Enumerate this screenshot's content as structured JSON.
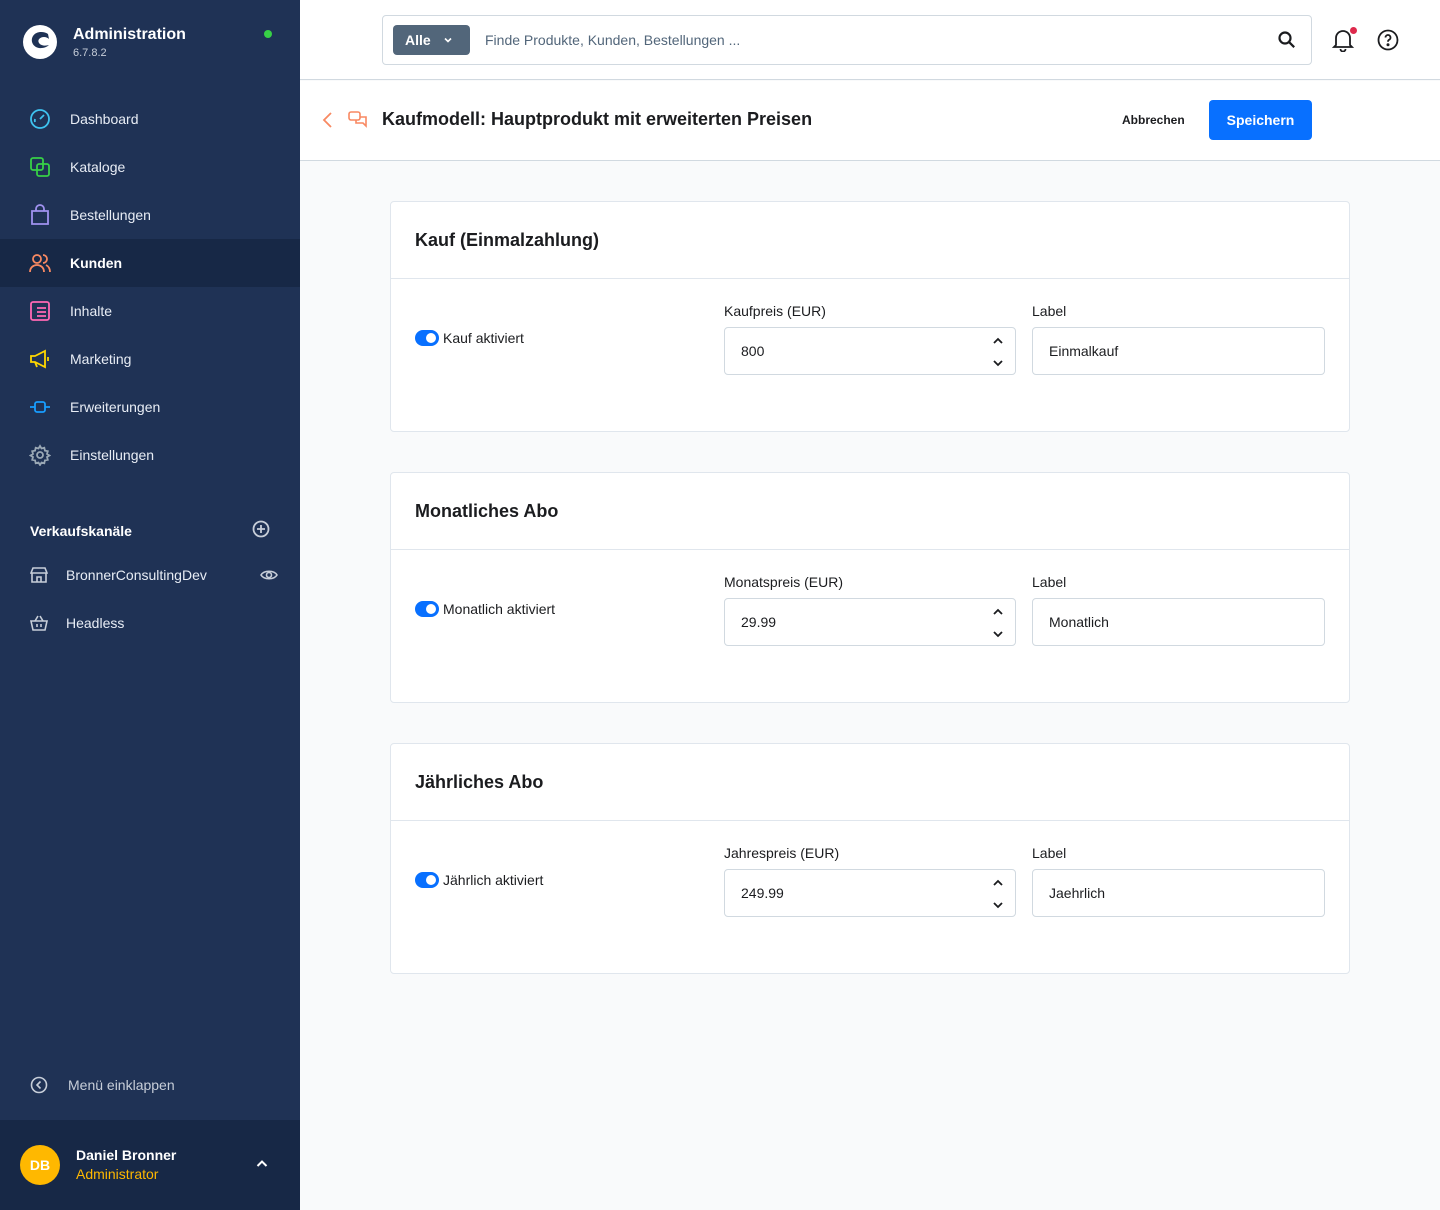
{
  "app": {
    "title": "Administration",
    "version": "6.7.8.2",
    "status_color": "#37d046"
  },
  "sidebar": {
    "items": [
      {
        "label": "Dashboard",
        "icon": "dashboard-icon",
        "color": "#3ec3f0"
      },
      {
        "label": "Kataloge",
        "icon": "catalog-icon",
        "color": "#37d046"
      },
      {
        "label": "Bestellungen",
        "icon": "shopping-bag-icon",
        "color": "#a092f0"
      },
      {
        "label": "Kunden",
        "icon": "users-icon",
        "color": "#f88962",
        "active": true
      },
      {
        "label": "Inhalte",
        "icon": "content-icon",
        "color": "#ff68b4"
      },
      {
        "label": "Marketing",
        "icon": "megaphone-icon",
        "color": "#ffd700"
      },
      {
        "label": "Erweiterungen",
        "icon": "plug-icon",
        "color": "#189eff"
      },
      {
        "label": "Einstellungen",
        "icon": "gear-icon",
        "color": "#9aa8b5"
      }
    ],
    "channels_title": "Verkaufskanäle",
    "channels": [
      {
        "label": "BronnerConsultingDev",
        "icon": "storefront-icon"
      },
      {
        "label": "Headless",
        "icon": "basket-icon"
      }
    ],
    "collapse_label": "Menü einklappen"
  },
  "user": {
    "initials": "DB",
    "name": "Daniel Bronner",
    "role": "Administrator"
  },
  "search": {
    "type_label": "Alle",
    "placeholder": "Finde Produkte, Kunden, Bestellungen ..."
  },
  "header": {
    "title": "Kaufmodell: Hauptprodukt mit erweiterten Preisen",
    "cancel_label": "Abbrechen",
    "save_label": "Speichern"
  },
  "cards": [
    {
      "title": "Kauf (Einmalzahlung)",
      "toggle_label": "Kauf aktiviert",
      "toggle_on": true,
      "price_label": "Kaufpreis (EUR)",
      "price_value": "800",
      "label_label": "Label",
      "label_value": "Einmalkauf"
    },
    {
      "title": "Monatliches Abo",
      "toggle_label": "Monatlich aktiviert",
      "toggle_on": true,
      "price_label": "Monatspreis (EUR)",
      "price_value": "29.99",
      "label_label": "Label",
      "label_value": "Monatlich"
    },
    {
      "title": "Jährliches Abo",
      "toggle_label": "Jährlich aktiviert",
      "toggle_on": true,
      "price_label": "Jahrespreis (EUR)",
      "price_value": "249.99",
      "label_label": "Label",
      "label_value": "Jaehrlich"
    }
  ],
  "colors": {
    "sidebar_bg": "#1f3255",
    "primary": "#0870ff",
    "avatar": "#ffb800",
    "module_accent": "#f88962"
  }
}
